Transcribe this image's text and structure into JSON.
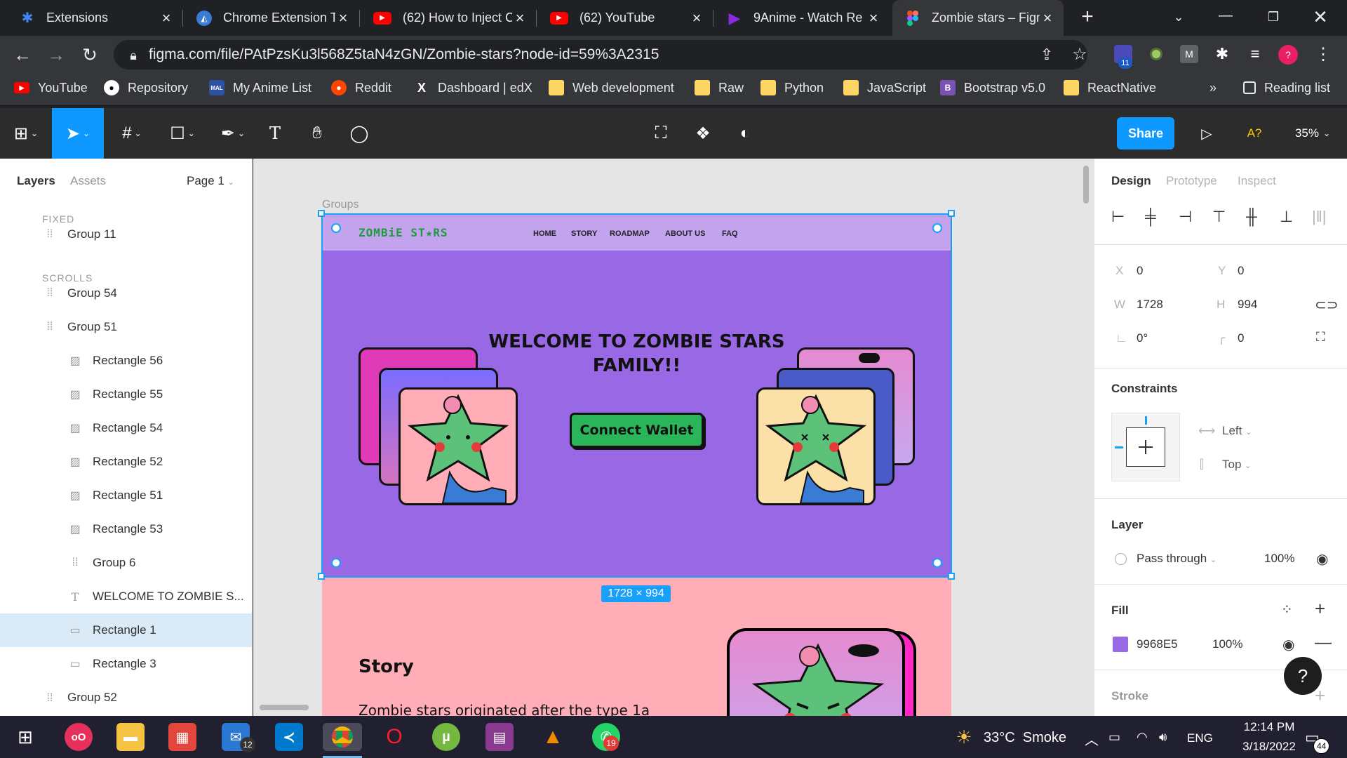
{
  "browser": {
    "tabs": [
      {
        "title": "Extensions",
        "icon": "puzzle-icon",
        "color": "#4285f4"
      },
      {
        "title": "Chrome Extension T",
        "icon": "chrome-dev-icon",
        "color": "#3a7bd5"
      },
      {
        "title": "(62) How to Inject C",
        "icon": "youtube-icon",
        "color": "#ff0000"
      },
      {
        "title": "(62) YouTube",
        "icon": "youtube-icon",
        "color": "#ff0000"
      },
      {
        "title": "9Anime - Watch Re",
        "icon": "play-icon",
        "color": "#8a2be2"
      },
      {
        "title": "Zombie stars – Figm",
        "icon": "figma-icon",
        "color": "#f24e1e"
      }
    ],
    "url": "figma.com/file/PAtPzsKu3l568Z5taN4zGN/Zombie-stars?node-id=59%3A2315",
    "extension_badge": "11",
    "bookmarks": [
      "YouTube",
      "Repository",
      "My Anime List",
      "Reddit",
      "Dashboard | edX",
      "Web development",
      "Raw",
      "Python",
      "JavaScript",
      "Bootstrap v5.0",
      "ReactNative"
    ],
    "bookmark_more": "»",
    "reading_list": "Reading list"
  },
  "figma": {
    "share_label": "Share",
    "font_warning": "A?",
    "zoom": "35%",
    "panel_tabs": {
      "layers": "Layers",
      "assets": "Assets",
      "page": "Page 1"
    },
    "sections": {
      "fixed": "FIXED",
      "scrolls": "SCROLLS"
    },
    "layers": {
      "group11": "Group 11",
      "group54": "Group 54",
      "group51": "Group 51",
      "r56": "Rectangle 56",
      "r55": "Rectangle 55",
      "r54": "Rectangle 54",
      "r52": "Rectangle 52",
      "r51": "Rectangle 51",
      "r53": "Rectangle 53",
      "group6": "Group 6",
      "welcome": "WELCOME TO ZOMBIE S...",
      "rect1": "Rectangle 1",
      "rect3": "Rectangle 3",
      "group52": "Group 52"
    },
    "canvas": {
      "frame_label": "Groups",
      "size_badge": "1728 × 994",
      "logo": "ZOMBiE ST★RS",
      "nav": [
        "HOME",
        "STORY",
        "ROADMAP",
        "ABOUT US",
        "FAQ"
      ],
      "hero_title_1": "WELCOME TO ZOMBIE STARS",
      "hero_title_2": "FAMILY!!",
      "connect_wallet": "Connect Wallet",
      "story_heading": "Story",
      "story_text": "Zombie stars originated after the type 1a"
    },
    "design_panel": {
      "tabs": [
        "Design",
        "Prototype",
        "Inspect"
      ],
      "x_label": "X",
      "x": "0",
      "y_label": "Y",
      "y": "0",
      "w_label": "W",
      "w": "1728",
      "h_label": "H",
      "h": "994",
      "rotation": "0°",
      "radius": "0",
      "constraints_title": "Constraints",
      "constraint_h": "Left",
      "constraint_v": "Top",
      "layer_title": "Layer",
      "blend": "Pass through",
      "layer_opacity": "100%",
      "fill_title": "Fill",
      "fill_hex": "9968E5",
      "fill_color": "#9968e5",
      "fill_opacity": "100%",
      "stroke_title": "Stroke",
      "help": "?"
    }
  },
  "taskbar": {
    "weather": "33°C  Smoke",
    "lang": "ENG",
    "time": "12:14 PM",
    "date": "3/18/2022",
    "notif_count": "44",
    "mail_badge": "12",
    "whatsapp_badge": "19"
  }
}
